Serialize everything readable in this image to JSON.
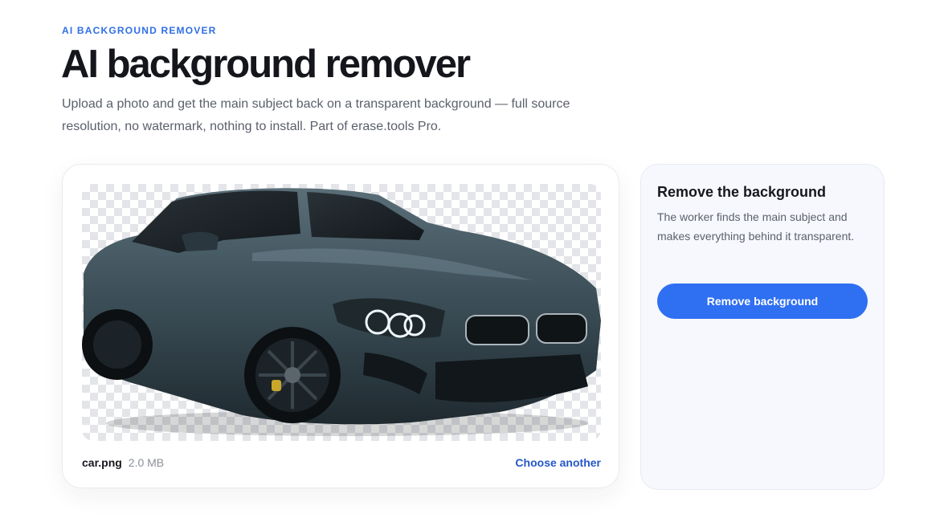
{
  "header": {
    "eyebrow": "AI BACKGROUND REMOVER",
    "title": "AI background remover",
    "subtitle": "Upload a photo and get the main subject back on a transparent background — full source resolution, no watermark, nothing to install. Part of erase.tools Pro."
  },
  "upload": {
    "file_name": "car.png",
    "file_size": "2.0 MB",
    "choose_label": "Choose another",
    "preview_image": "car-cutout-on-transparent-checkerboard"
  },
  "panel": {
    "title": "Remove the background",
    "description": "The worker finds the main subject and makes everything behind it transparent.",
    "button_label": "Remove background"
  },
  "colors": {
    "accent": "#2f6ff2",
    "eyebrow": "#2f6fe6",
    "link": "#2557c8",
    "car_body": "#3c4f58"
  }
}
